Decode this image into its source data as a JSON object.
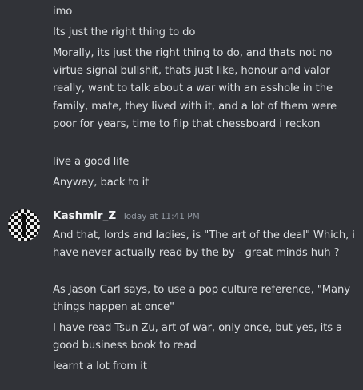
{
  "previous_messages": [
    "imo",
    "Its just the right thing to do",
    "Morally, its just the right thing to do, and thats not no virtue signal bullshit, thats just like, honour and valor really, want to talk about a war with an asshole in the family, mate, they lived with it, and a lot of them were poor for years, time to flip that chessboard i reckon",
    "live a good life",
    "Anyway, back to it"
  ],
  "message_group": {
    "author": "Kashmir_Z",
    "timestamp": "Today at 11:41 PM",
    "avatar_icon": "checkered-avatar-icon",
    "messages": [
      "And that, lords and ladies, is \"The art of the deal\" Which, i have never actually read by the by - great minds huh ?",
      "As Jason Carl says, to use a pop culture reference, \"Many things happen at once\"",
      "I have read Tsun Zu, art of war, only once, but yes, its a good business book to read",
      "learnt a lot from it"
    ]
  },
  "colors": {
    "background": "#313338",
    "text": "#dbdee1",
    "author": "#f2f3f5",
    "timestamp": "#949ba4"
  }
}
